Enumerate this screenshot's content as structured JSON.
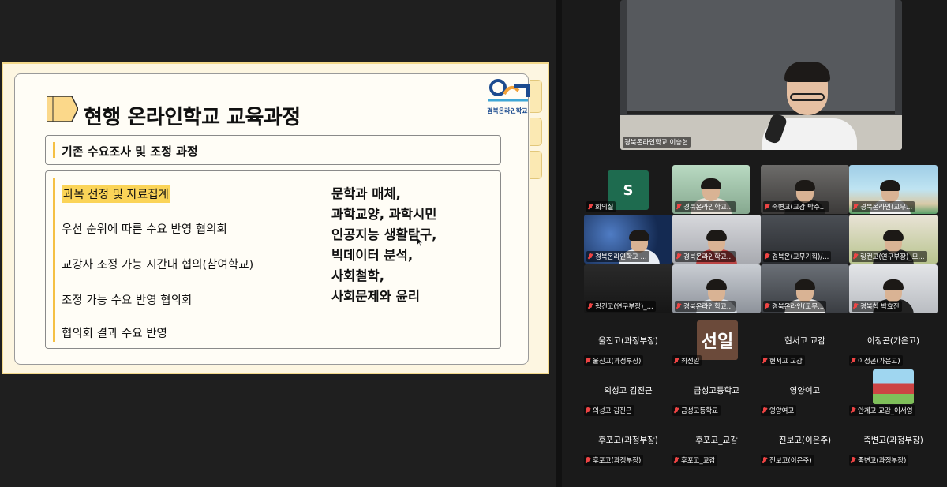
{
  "slide": {
    "title": "현행 온라인학교 교육과정",
    "logo_text": "경북온라인학교",
    "sub_title": "기존 수요조사 및 조정 과정",
    "steps": [
      "과목 선정 및 자료집계",
      "우선 순위에 따른 수요 반영 협의회",
      "교강사 조정 가능 시간대 협의(참여학교)",
      "조정 가능 수요 반영 협의회",
      "협의회 결과 수요 반영"
    ],
    "subjects": [
      "문학과 매체,",
      "과학교양, 과학시민",
      "인공지능 생활탐구,",
      "빅데이터 분석,",
      "사회철학,",
      "사회문제와 윤리"
    ],
    "highlight_color": "#fbd458",
    "accent_color": "#f5c044"
  },
  "speaker": {
    "label": "경북온라인학교 이승현"
  },
  "video_tiles": [
    {
      "label": "회의실",
      "avatar": "S"
    },
    {
      "label": "경북온라인학교..."
    },
    {
      "label": "죽변고(교감 박수..."
    },
    {
      "label": "경북온라인(교무..."
    },
    {
      "label": "경북온라인학교 ..."
    },
    {
      "label": "경북온라인학교..."
    },
    {
      "label": "경북온(교무기획)/..."
    },
    {
      "label": "링컨고(연구부장)_모..."
    },
    {
      "label": "링컨고(연구부장)_..."
    },
    {
      "label": "경북온라인학교..."
    },
    {
      "label": "경북온라인(교무..."
    },
    {
      "label": "경북청 박효진"
    }
  ],
  "name_cards": [
    {
      "big": "울진고(과정부장)",
      "small": "울진고(과정부장)"
    },
    {
      "big": "",
      "small": "최선일",
      "avatar": "선일"
    },
    {
      "big": "현서고 교감",
      "small": "현서고 교감"
    },
    {
      "big": "이정곤(가은고)",
      "small": "이정곤(가은고)"
    },
    {
      "big": "의성고 김진근",
      "small": "의성고 김진근"
    },
    {
      "big": "금성고등학교",
      "small": "금성고등학교"
    },
    {
      "big": "영양여고",
      "small": "영양여고"
    },
    {
      "big": "",
      "small": "안계고 교감_이서영"
    },
    {
      "big": "후포고(과정부장)",
      "small": "후포고(과정부장)"
    },
    {
      "big": "후포고_교감",
      "small": "후포고_교감"
    },
    {
      "big": "진보고(이은주)",
      "small": "진보고(이은주)"
    },
    {
      "big": "죽변고(과정부장)",
      "small": "죽변고(과정부장)"
    }
  ]
}
